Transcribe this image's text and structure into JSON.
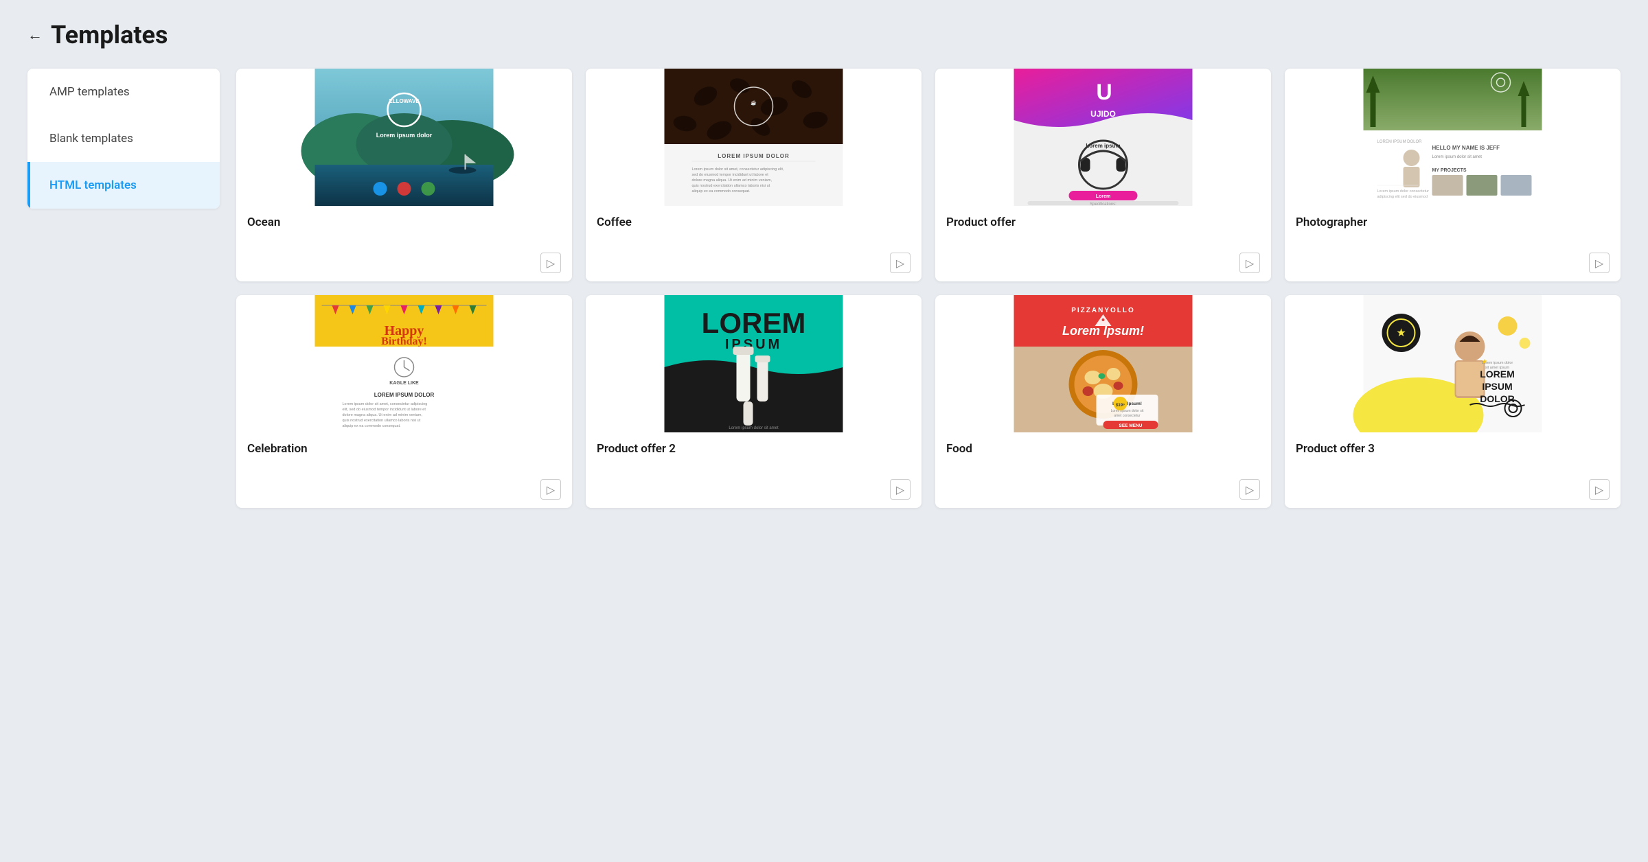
{
  "page": {
    "title": "Templates",
    "back_label": "←"
  },
  "sidebar": {
    "items": [
      {
        "id": "amp",
        "label": "AMP templates",
        "active": false
      },
      {
        "id": "blank",
        "label": "Blank templates",
        "active": false
      },
      {
        "id": "html",
        "label": "HTML templates",
        "active": true
      }
    ]
  },
  "templates": {
    "row1": [
      {
        "id": "ocean",
        "name": "Ocean",
        "thumb_type": "ocean",
        "use_icon": "▷"
      },
      {
        "id": "coffee",
        "name": "Coffee",
        "thumb_type": "coffee",
        "use_icon": "▷"
      },
      {
        "id": "product-offer",
        "name": "Product offer",
        "thumb_type": "product",
        "use_icon": "▷"
      },
      {
        "id": "photographer",
        "name": "Photographer",
        "thumb_type": "photographer",
        "use_icon": "▷"
      }
    ],
    "row2": [
      {
        "id": "celebration",
        "name": "Celebration",
        "thumb_type": "celebration",
        "use_icon": "▷"
      },
      {
        "id": "product-offer-2",
        "name": "Product offer 2",
        "thumb_type": "product2",
        "use_icon": "▷"
      },
      {
        "id": "food",
        "name": "Food",
        "thumb_type": "food",
        "use_icon": "▷"
      },
      {
        "id": "product-offer-3",
        "name": "Product offer 3",
        "thumb_type": "product3",
        "use_icon": "▷"
      }
    ]
  },
  "colors": {
    "active_sidebar": "#1a9bf4",
    "active_border": "#1a9bf4",
    "bg": "#e8ecf0"
  }
}
